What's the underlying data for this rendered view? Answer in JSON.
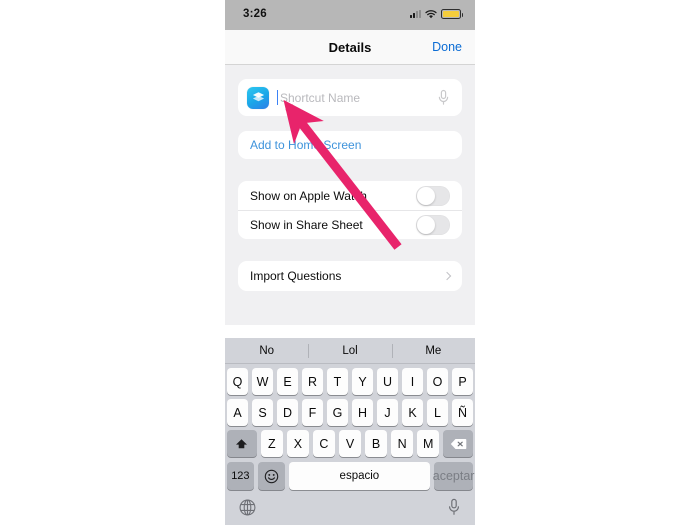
{
  "device": {
    "status_bar": {
      "time": "3:26",
      "signal_icon": "cellular-signal-icon",
      "wifi_icon": "wifi-icon",
      "battery_icon": "battery-icon",
      "battery_color": "#f5cd3c"
    }
  },
  "navbar": {
    "title": "Details",
    "done_label": "Done",
    "done_color": "#0b6cd4"
  },
  "form": {
    "shortcut_icon": "shortcuts-app-icon",
    "name_placeholder": "Shortcut Name",
    "name_value": "",
    "dictation_icon": "microphone-icon",
    "add_to_home_screen": "Add to Home Screen",
    "add_to_home_screen_color": "#3e93db",
    "toggles": [
      {
        "label": "Show on Apple Watch",
        "state": "off"
      },
      {
        "label": "Show in Share Sheet",
        "state": "off"
      }
    ],
    "import_questions": "Import Questions",
    "disclosure_icon": "chevron-right-icon"
  },
  "keyboard": {
    "language": "es",
    "predictions": [
      "No",
      "Lol",
      "Me"
    ],
    "row1": [
      "Q",
      "W",
      "E",
      "R",
      "T",
      "Y",
      "U",
      "I",
      "O",
      "P"
    ],
    "row2": [
      "A",
      "S",
      "D",
      "F",
      "G",
      "H",
      "J",
      "K",
      "L",
      "Ñ"
    ],
    "row3": [
      "Z",
      "X",
      "C",
      "V",
      "B",
      "N",
      "M"
    ],
    "shift_icon": "shift-arrow-icon",
    "delete_icon": "backspace-icon",
    "numbers_label": "123",
    "emoji_icon": "emoji-smiley-icon",
    "space_label": "espacio",
    "return_label": "aceptar",
    "globe_icon": "globe-icon",
    "dictation_icon": "microphone-icon"
  },
  "annotation": {
    "arrow_icon": "pointer-arrow-annotation",
    "arrow_color": "#e8246b",
    "points_to": "Shortcut Name"
  }
}
